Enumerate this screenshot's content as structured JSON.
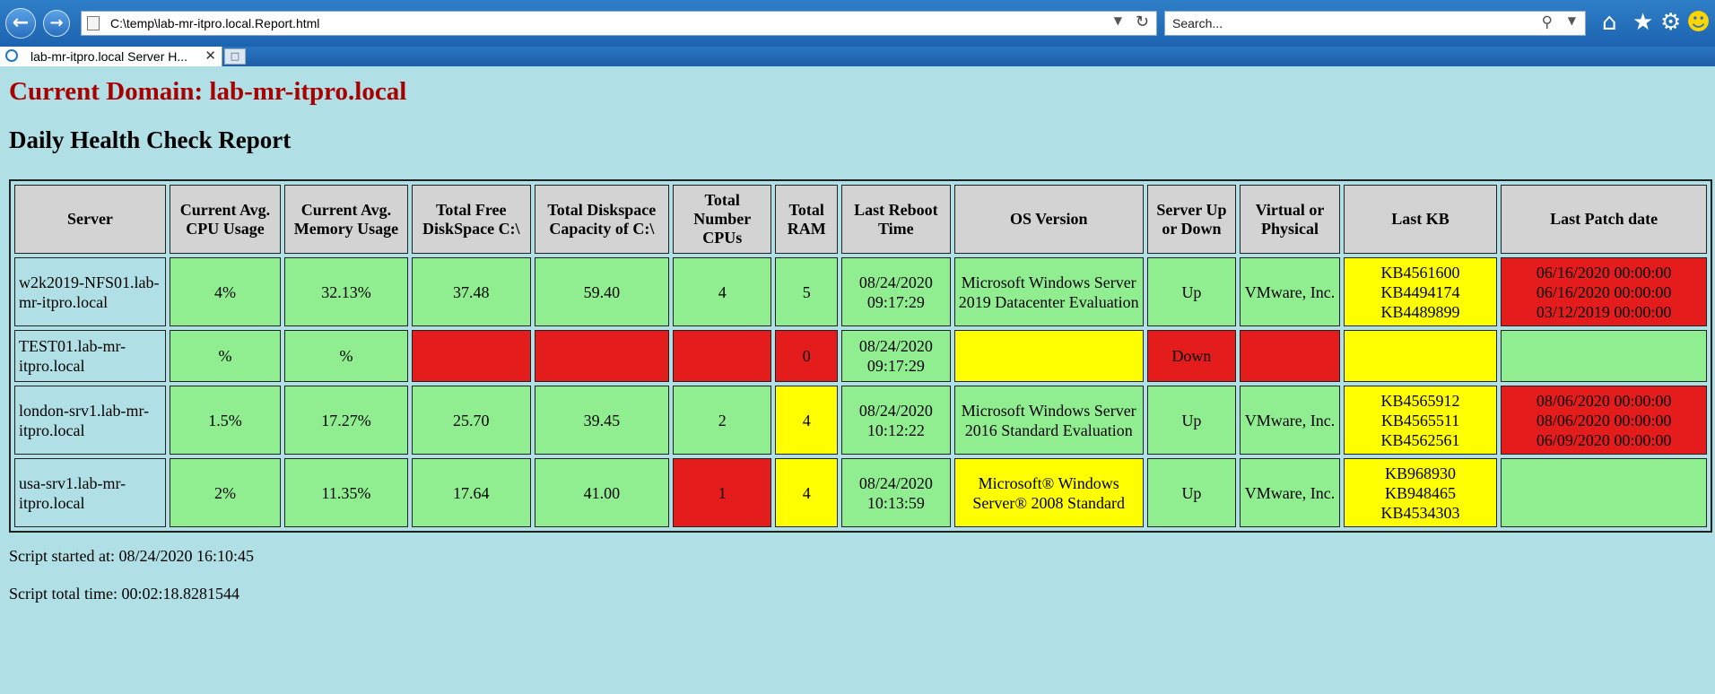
{
  "browser": {
    "address": "C:\\temp\\lab-mr-itpro.local.Report.html",
    "search_placeholder": "Search...",
    "tab_title": "lab-mr-itpro.local Server H..."
  },
  "page": {
    "domain_heading": "Current Domain: lab-mr-itpro.local",
    "report_title": "Daily Health Check Report",
    "script_started": "Script started at: 08/24/2020 16:10:45",
    "script_total": "Script total time: 00:02:18.8281544"
  },
  "table": {
    "headers": [
      "Server",
      "Current Avg. CPU Usage",
      "Current Avg. Memory Usage",
      "Total Free DiskSpace C:\\",
      "Total Diskspace Capacity of C:\\",
      "Total Number CPUs",
      "Total RAM",
      "Last Reboot Time",
      "OS Version",
      "Server Up or Down",
      "Virtual or Physical",
      "Last KB",
      "Last Patch date"
    ],
    "rows": [
      {
        "server": "w2k2019-NFS01.lab-mr-itpro.local",
        "cpu": "4%",
        "memory": "32.13%",
        "free": "37.48",
        "capacity": "59.40",
        "cpus": "4",
        "ram": "5",
        "reboot": "08/24/2020 09:17:29",
        "os": "Microsoft Windows Server 2019 Datacenter Evaluation",
        "status": "Up",
        "virtual": "VMware, Inc.",
        "kb": [
          "KB4561600",
          "KB4494174",
          "KB4489899"
        ],
        "patch": [
          "06/16/2020 00:00:00",
          "06/16/2020 00:00:00",
          "03/12/2019 00:00:00"
        ],
        "colors": {
          "cpu": "#90ee90",
          "memory": "#90ee90",
          "free": "#90ee90",
          "capacity": "#90ee90",
          "cpus": "#90ee90",
          "ram": "#90ee90",
          "reboot": "#90ee90",
          "os": "#90ee90",
          "status": "#90ee90",
          "virtual": "#90ee90",
          "kb": "#ffff00",
          "patch": "#e51c1c"
        }
      },
      {
        "server": "TEST01.lab-mr-itpro.local",
        "cpu": "%",
        "memory": "%",
        "free": "",
        "capacity": "",
        "cpus": "",
        "ram": "0",
        "reboot": "08/24/2020 09:17:29",
        "os": "",
        "status": "Down",
        "virtual": "",
        "kb": [],
        "patch": [],
        "colors": {
          "cpu": "#90ee90",
          "memory": "#90ee90",
          "free": "#e51c1c",
          "capacity": "#e51c1c",
          "cpus": "#e51c1c",
          "ram": "#e51c1c",
          "reboot": "#90ee90",
          "os": "#ffff00",
          "status": "#e51c1c",
          "virtual": "#e51c1c",
          "kb": "#ffff00",
          "patch": "#90ee90"
        }
      },
      {
        "server": "london-srv1.lab-mr-itpro.local",
        "cpu": "1.5%",
        "memory": "17.27%",
        "free": "25.70",
        "capacity": "39.45",
        "cpus": "2",
        "ram": "4",
        "reboot": "08/24/2020 10:12:22",
        "os": "Microsoft Windows Server 2016 Standard Evaluation",
        "status": "Up",
        "virtual": "VMware, Inc.",
        "kb": [
          "KB4565912",
          "KB4565511",
          "KB4562561"
        ],
        "patch": [
          "08/06/2020 00:00:00",
          "08/06/2020 00:00:00",
          "06/09/2020 00:00:00"
        ],
        "colors": {
          "cpu": "#90ee90",
          "memory": "#90ee90",
          "free": "#90ee90",
          "capacity": "#90ee90",
          "cpus": "#90ee90",
          "ram": "#ffff00",
          "reboot": "#90ee90",
          "os": "#90ee90",
          "status": "#90ee90",
          "virtual": "#90ee90",
          "kb": "#ffff00",
          "patch": "#e51c1c"
        }
      },
      {
        "server": "usa-srv1.lab-mr-itpro.local",
        "cpu": "2%",
        "memory": "11.35%",
        "free": "17.64",
        "capacity": "41.00",
        "cpus": "1",
        "ram": "4",
        "reboot": "08/24/2020 10:13:59",
        "os": "Microsoft® Windows Server® 2008 Standard",
        "status": "Up",
        "virtual": "VMware, Inc.",
        "kb": [
          "KB968930",
          "KB948465",
          "KB4534303"
        ],
        "patch": [],
        "colors": {
          "cpu": "#90ee90",
          "memory": "#90ee90",
          "free": "#90ee90",
          "capacity": "#90ee90",
          "cpus": "#e51c1c",
          "ram": "#ffff00",
          "reboot": "#90ee90",
          "os": "#ffff00",
          "status": "#90ee90",
          "virtual": "#90ee90",
          "kb": "#ffff00",
          "patch": "#90ee90"
        }
      }
    ]
  },
  "icons": [
    "back-icon",
    "forward-icon",
    "refresh-icon",
    "search-icon",
    "home-icon",
    "star-icon",
    "gear-icon",
    "smiley-icon"
  ]
}
